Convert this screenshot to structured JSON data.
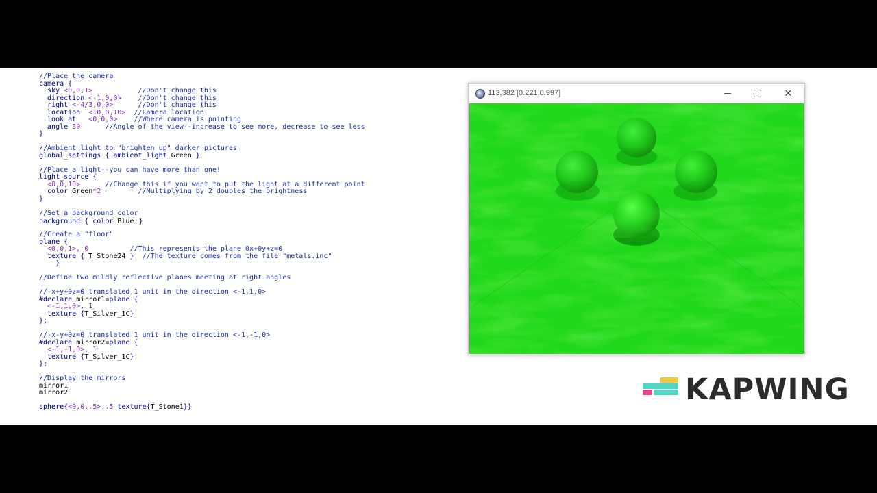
{
  "editor": {
    "lines": [
      [
        {
          "t": "//Place the camera",
          "c": "c"
        }
      ],
      [
        {
          "t": "camera {",
          "c": "k"
        }
      ],
      [
        {
          "t": "  sky ",
          "c": "k"
        },
        {
          "t": "<0,0,1>",
          "c": "v"
        },
        {
          "t": "           //Don't change this",
          "c": "c"
        }
      ],
      [
        {
          "t": "  direction ",
          "c": "k"
        },
        {
          "t": "<-1,0,0>",
          "c": "v"
        },
        {
          "t": "    //Don't change this",
          "c": "c"
        }
      ],
      [
        {
          "t": "  right ",
          "c": "k"
        },
        {
          "t": "<-4/3,0,0>",
          "c": "v"
        },
        {
          "t": "      //Don't change this",
          "c": "c"
        }
      ],
      [
        {
          "t": "  location  ",
          "c": "k"
        },
        {
          "t": "<10,0,10>",
          "c": "v"
        },
        {
          "t": "  //Camera location",
          "c": "c"
        }
      ],
      [
        {
          "t": "  look_at   ",
          "c": "k"
        },
        {
          "t": "<0,0,0>",
          "c": "v"
        },
        {
          "t": "    //Where camera is pointing",
          "c": "c"
        }
      ],
      [
        {
          "t": "  angle ",
          "c": "k"
        },
        {
          "t": "30",
          "c": "v"
        },
        {
          "t": "      //Angle of the view--increase to see more, decrease to see less",
          "c": "c"
        }
      ],
      [
        {
          "t": "}",
          "c": "k"
        }
      ],
      [
        {
          "t": "",
          "c": "n"
        }
      ],
      [
        {
          "t": "//Ambient light to \"brighten up\" darker pictures",
          "c": "c"
        }
      ],
      [
        {
          "t": "global_settings { ambient_light ",
          "c": "k"
        },
        {
          "t": "Green",
          "c": "n"
        },
        {
          "t": " }",
          "c": "k"
        }
      ],
      [
        {
          "t": "",
          "c": "n"
        }
      ],
      [
        {
          "t": "//Place a light--you can have more than one!",
          "c": "c"
        }
      ],
      [
        {
          "t": "light_source {",
          "c": "k"
        }
      ],
      [
        {
          "t": "  ",
          "c": "n"
        },
        {
          "t": "<0,0,10>",
          "c": "v"
        },
        {
          "t": "      //Change this if you want to put the light at a different point",
          "c": "c"
        }
      ],
      [
        {
          "t": "  color ",
          "c": "k"
        },
        {
          "t": "Green",
          "c": "n"
        },
        {
          "t": "*2",
          "c": "v"
        },
        {
          "t": "         //Multiplying by 2 doubles the brightness",
          "c": "c"
        }
      ],
      [
        {
          "t": "}",
          "c": "k"
        }
      ],
      [
        {
          "t": "",
          "c": "n"
        }
      ],
      [
        {
          "t": "//Set a background color",
          "c": "c"
        }
      ],
      [
        {
          "t": "background { color ",
          "c": "k"
        },
        {
          "t": "Blue",
          "c": "n"
        },
        {
          "t": "|",
          "c": "caret"
        },
        {
          "t": " }",
          "c": "k"
        }
      ],
      [
        {
          "t": "",
          "c": "n"
        }
      ],
      [
        {
          "t": "//Create a \"floor\"",
          "c": "c"
        }
      ],
      [
        {
          "t": "plane {",
          "c": "k"
        }
      ],
      [
        {
          "t": "  <0,0,1>, 0",
          "c": "v"
        },
        {
          "t": "          //This represents the plane 0x+0y+z=0",
          "c": "c"
        }
      ],
      [
        {
          "t": "  texture { ",
          "c": "k"
        },
        {
          "t": "T_Stone24",
          "c": "n"
        },
        {
          "t": " }",
          "c": "k"
        },
        {
          "t": "  //The texture comes from the file \"metals.inc\"",
          "c": "c"
        }
      ],
      [
        {
          "t": "    }",
          "c": "k"
        }
      ],
      [
        {
          "t": "",
          "c": "n"
        }
      ],
      [
        {
          "t": "//Define two mildly reflective planes meeting at right angles",
          "c": "c"
        }
      ],
      [
        {
          "t": "",
          "c": "n"
        }
      ],
      [
        {
          "t": "//-x+y+0z=0 translated 1 unit in the direction <-1,1,0>",
          "c": "c"
        }
      ],
      [
        {
          "t": "#declare ",
          "c": "k"
        },
        {
          "t": "mirror1=",
          "c": "n"
        },
        {
          "t": "plane {",
          "c": "k"
        }
      ],
      [
        {
          "t": "  <-1,1,0>, 1",
          "c": "v"
        }
      ],
      [
        {
          "t": "  texture {",
          "c": "k"
        },
        {
          "t": "T_Silver_1C",
          "c": "n"
        },
        {
          "t": "}",
          "c": "k"
        }
      ],
      [
        {
          "t": "};",
          "c": "k"
        }
      ],
      [
        {
          "t": "",
          "c": "n"
        }
      ],
      [
        {
          "t": "//-x-y+0z=0 translated 1 unit in the direction <-1,-1,0>",
          "c": "c"
        }
      ],
      [
        {
          "t": "#declare ",
          "c": "k"
        },
        {
          "t": "mirror2=",
          "c": "n"
        },
        {
          "t": "plane {",
          "c": "k"
        }
      ],
      [
        {
          "t": "  <-1,-1,0>, 1",
          "c": "v"
        }
      ],
      [
        {
          "t": "  texture {",
          "c": "k"
        },
        {
          "t": "T_Silver_1C",
          "c": "n"
        },
        {
          "t": "}",
          "c": "k"
        }
      ],
      [
        {
          "t": "};",
          "c": "k"
        }
      ],
      [
        {
          "t": "",
          "c": "n"
        }
      ],
      [
        {
          "t": "//Display the mirrors",
          "c": "c"
        }
      ],
      [
        {
          "t": "mirror1",
          "c": "n"
        }
      ],
      [
        {
          "t": "mirror2",
          "c": "n"
        }
      ],
      [
        {
          "t": "",
          "c": "n"
        }
      ],
      [
        {
          "t": "sphere{",
          "c": "k"
        },
        {
          "t": "<0,0,.5>,.5",
          "c": "v"
        },
        {
          "t": " texture{",
          "c": "k"
        },
        {
          "t": "T_Stone1",
          "c": "n"
        },
        {
          "t": "}}",
          "c": "k"
        }
      ]
    ]
  },
  "render_window": {
    "title": "113,382 [0.221,0.997]",
    "minimize_glyph": "—",
    "close_glyph": "✕"
  },
  "colors": {
    "scene_green": "#20d81a",
    "scene_green_dark": "#0fa60c",
    "scene_green_light": "#3cf53a"
  },
  "logo": {
    "wordmark": "KAPWING",
    "bar_colors": [
      "#f5c842",
      "#4fd6c5",
      "#e84393",
      "#4fd6c5"
    ]
  }
}
